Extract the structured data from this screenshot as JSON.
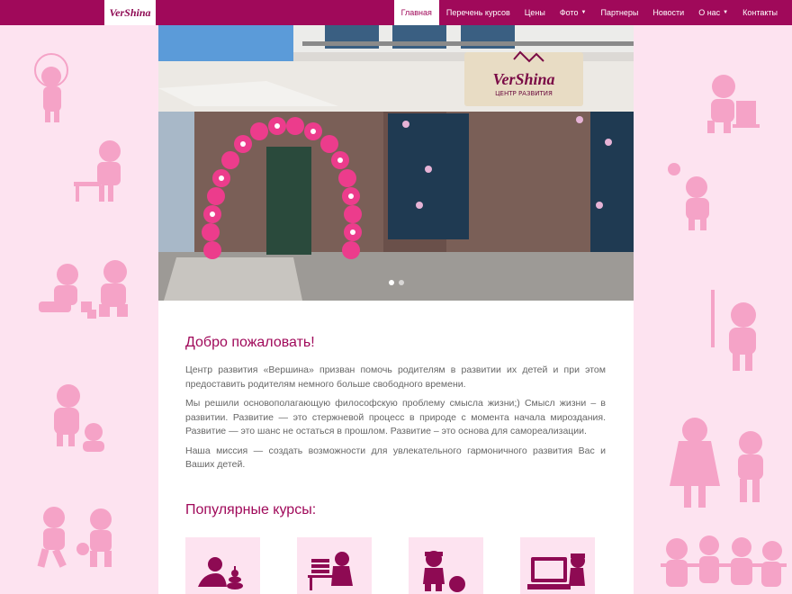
{
  "brand": {
    "logo_text": "VerShina",
    "sign_text": "VerShina",
    "sign_subtitle": "ЦЕНТР РАЗВИТИЯ"
  },
  "nav": {
    "items": [
      {
        "label": "Главная",
        "active": true
      },
      {
        "label": "Перечень курсов"
      },
      {
        "label": "Цены"
      },
      {
        "label": "Фото",
        "dropdown": true
      },
      {
        "label": "Партнеры"
      },
      {
        "label": "Новости"
      },
      {
        "label": "О нас",
        "dropdown": true
      },
      {
        "label": "Контакты"
      }
    ]
  },
  "carousel": {
    "slides_count": 2,
    "active_index": 0
  },
  "main": {
    "welcome_title": "Добро пожаловать!",
    "paragraphs": [
      "Центр развития «Вершина» призван помочь родителям в развитии их детей и при этом предоставить родителям немного больше свободного времени.",
      "Мы решили основополагающую философскую проблему смысла жизни;) Смысл жизни – в развитии. Развитие — это стержневой процесс в природе с момента начала мироздания. Развитие — это шанс не остаться в прошлом. Развитие – это основа для самореализации.",
      "Наша миссия — создать возможности для увлекательного гармоничного развития Вас и Ваших детей."
    ],
    "popular_title": "Популярные курсы:",
    "courses": [
      {
        "icon": "child-with-pyramid-icon"
      },
      {
        "icon": "child-reading-books-icon"
      },
      {
        "icon": "child-with-ball-icon"
      },
      {
        "icon": "child-at-computer-icon"
      }
    ]
  },
  "colors": {
    "brand": "#a0095a",
    "background": "#fde3f0",
    "decor": "#f5a3c7",
    "text": "#666666"
  }
}
